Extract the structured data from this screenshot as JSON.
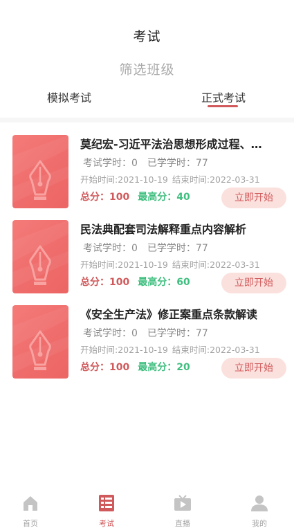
{
  "header": {
    "title": "考试",
    "filter_label": "筛选班级",
    "tabs": [
      {
        "label": "模拟考试",
        "active": false
      },
      {
        "label": "正式考试",
        "active": true
      }
    ]
  },
  "exams": [
    {
      "title": "莫纪宏-习近平法治思想形成过程、…",
      "exam_hours": "考试学时：0",
      "learned_hours": "已学学时：77",
      "start_time": "开始时间:2021-10-19",
      "end_time": "结束时间:2022-03-31",
      "total_score": "总分：100",
      "best_score": "最高分：40",
      "action_label": "立即开始"
    },
    {
      "title": "民法典配套司法解释重点内容解析",
      "exam_hours": "考试学时：0",
      "learned_hours": "已学学时：77",
      "start_time": "开始时间:2021-10-19",
      "end_time": "结束时间:2022-03-31",
      "total_score": "总分：100",
      "best_score": "最高分：60",
      "action_label": "立即开始"
    },
    {
      "title": "《安全生产法》修正案重点条款解读",
      "exam_hours": "考试学时：0",
      "learned_hours": "已学学时：77",
      "start_time": "开始时间:2021-10-19",
      "end_time": "结束时间:2022-03-31",
      "total_score": "总分：100",
      "best_score": "最高分：20",
      "action_label": "立即开始"
    }
  ],
  "tabbar": {
    "items": [
      {
        "label": "首页",
        "icon": "home-icon",
        "active": false
      },
      {
        "label": "考试",
        "icon": "exam-icon",
        "active": true
      },
      {
        "label": "直播",
        "icon": "live-tv-icon",
        "active": false
      },
      {
        "label": "我的",
        "icon": "profile-icon",
        "active": false
      }
    ]
  },
  "colors": {
    "accent": "#d0595b",
    "best_score": "#3fbf7f",
    "thumb": "#ef6d6c",
    "button_bg": "#fbe1dd"
  }
}
